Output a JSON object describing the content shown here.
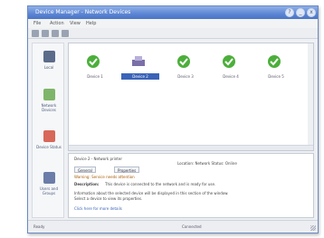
{
  "window": {
    "title": "Device Manager - Network Devices",
    "controls": [
      "?",
      "_",
      "x"
    ]
  },
  "menubar": {
    "items": [
      "File",
      "Action",
      "View",
      "Help"
    ]
  },
  "toolbar": {
    "icons": [
      "back-icon",
      "forward-icon",
      "refresh-icon",
      "help-icon"
    ]
  },
  "sidebar": {
    "items": [
      {
        "label": "Local",
        "icon": "computer-icon",
        "color": "#5b6b8a"
      },
      {
        "label": "Network Devices",
        "icon": "network-icon",
        "color": "#7fb56a"
      },
      {
        "label": "Device Status",
        "icon": "status-icon",
        "color": "#d7685a"
      },
      {
        "label": "Users and Groups",
        "icon": "users-icon",
        "color": "#6b7da8"
      }
    ]
  },
  "devices": [
    {
      "label": "Device 1",
      "icon": "check-icon",
      "selected": false
    },
    {
      "label": "Device 2",
      "icon": "printer-icon",
      "selected": true
    },
    {
      "label": "Device 3",
      "icon": "check-icon",
      "selected": false
    },
    {
      "label": "Device 4",
      "icon": "check-icon",
      "selected": false
    },
    {
      "label": "Device 5",
      "icon": "check-icon",
      "selected": false
    }
  ],
  "details": {
    "name_line": "Device 2 - Network printer",
    "info_line": "Location: Network   Status: Online",
    "tabs": [
      "General",
      "Properties"
    ],
    "status_line": "Warning: Service needs attention",
    "desc_title": "Description:",
    "desc_text": "This device is connected to the network and is ready for use.",
    "para_line1": "Information about the selected device will be displayed in this section of the window.",
    "para_line2": "Select a device to view its properties.",
    "link": "Click here for more details"
  },
  "status": {
    "left": "Ready",
    "middle": "Connected"
  },
  "colors": {
    "accent": "#3b64b8",
    "ok": "#4caf3a",
    "title": "#5c86d4"
  }
}
